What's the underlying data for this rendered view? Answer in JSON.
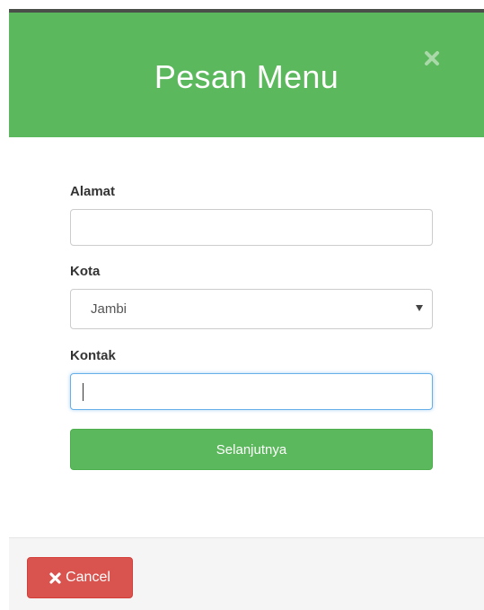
{
  "modal": {
    "title": "Pesan Menu",
    "close_icon": "close-icon"
  },
  "form": {
    "alamat": {
      "label": "Alamat",
      "value": "",
      "placeholder": ""
    },
    "kota": {
      "label": "Kota",
      "selected": "Jambi"
    },
    "kontak": {
      "label": "Kontak",
      "value": "",
      "placeholder": ""
    },
    "next_label": "Selanjutnya"
  },
  "footer": {
    "cancel_label": "Cancel",
    "cancel_icon": "close-icon"
  },
  "colors": {
    "header_bg": "#5cb85c",
    "primary_button": "#5cb85c",
    "cancel_button": "#d9534f",
    "footer_bg": "#f5f5f5"
  }
}
